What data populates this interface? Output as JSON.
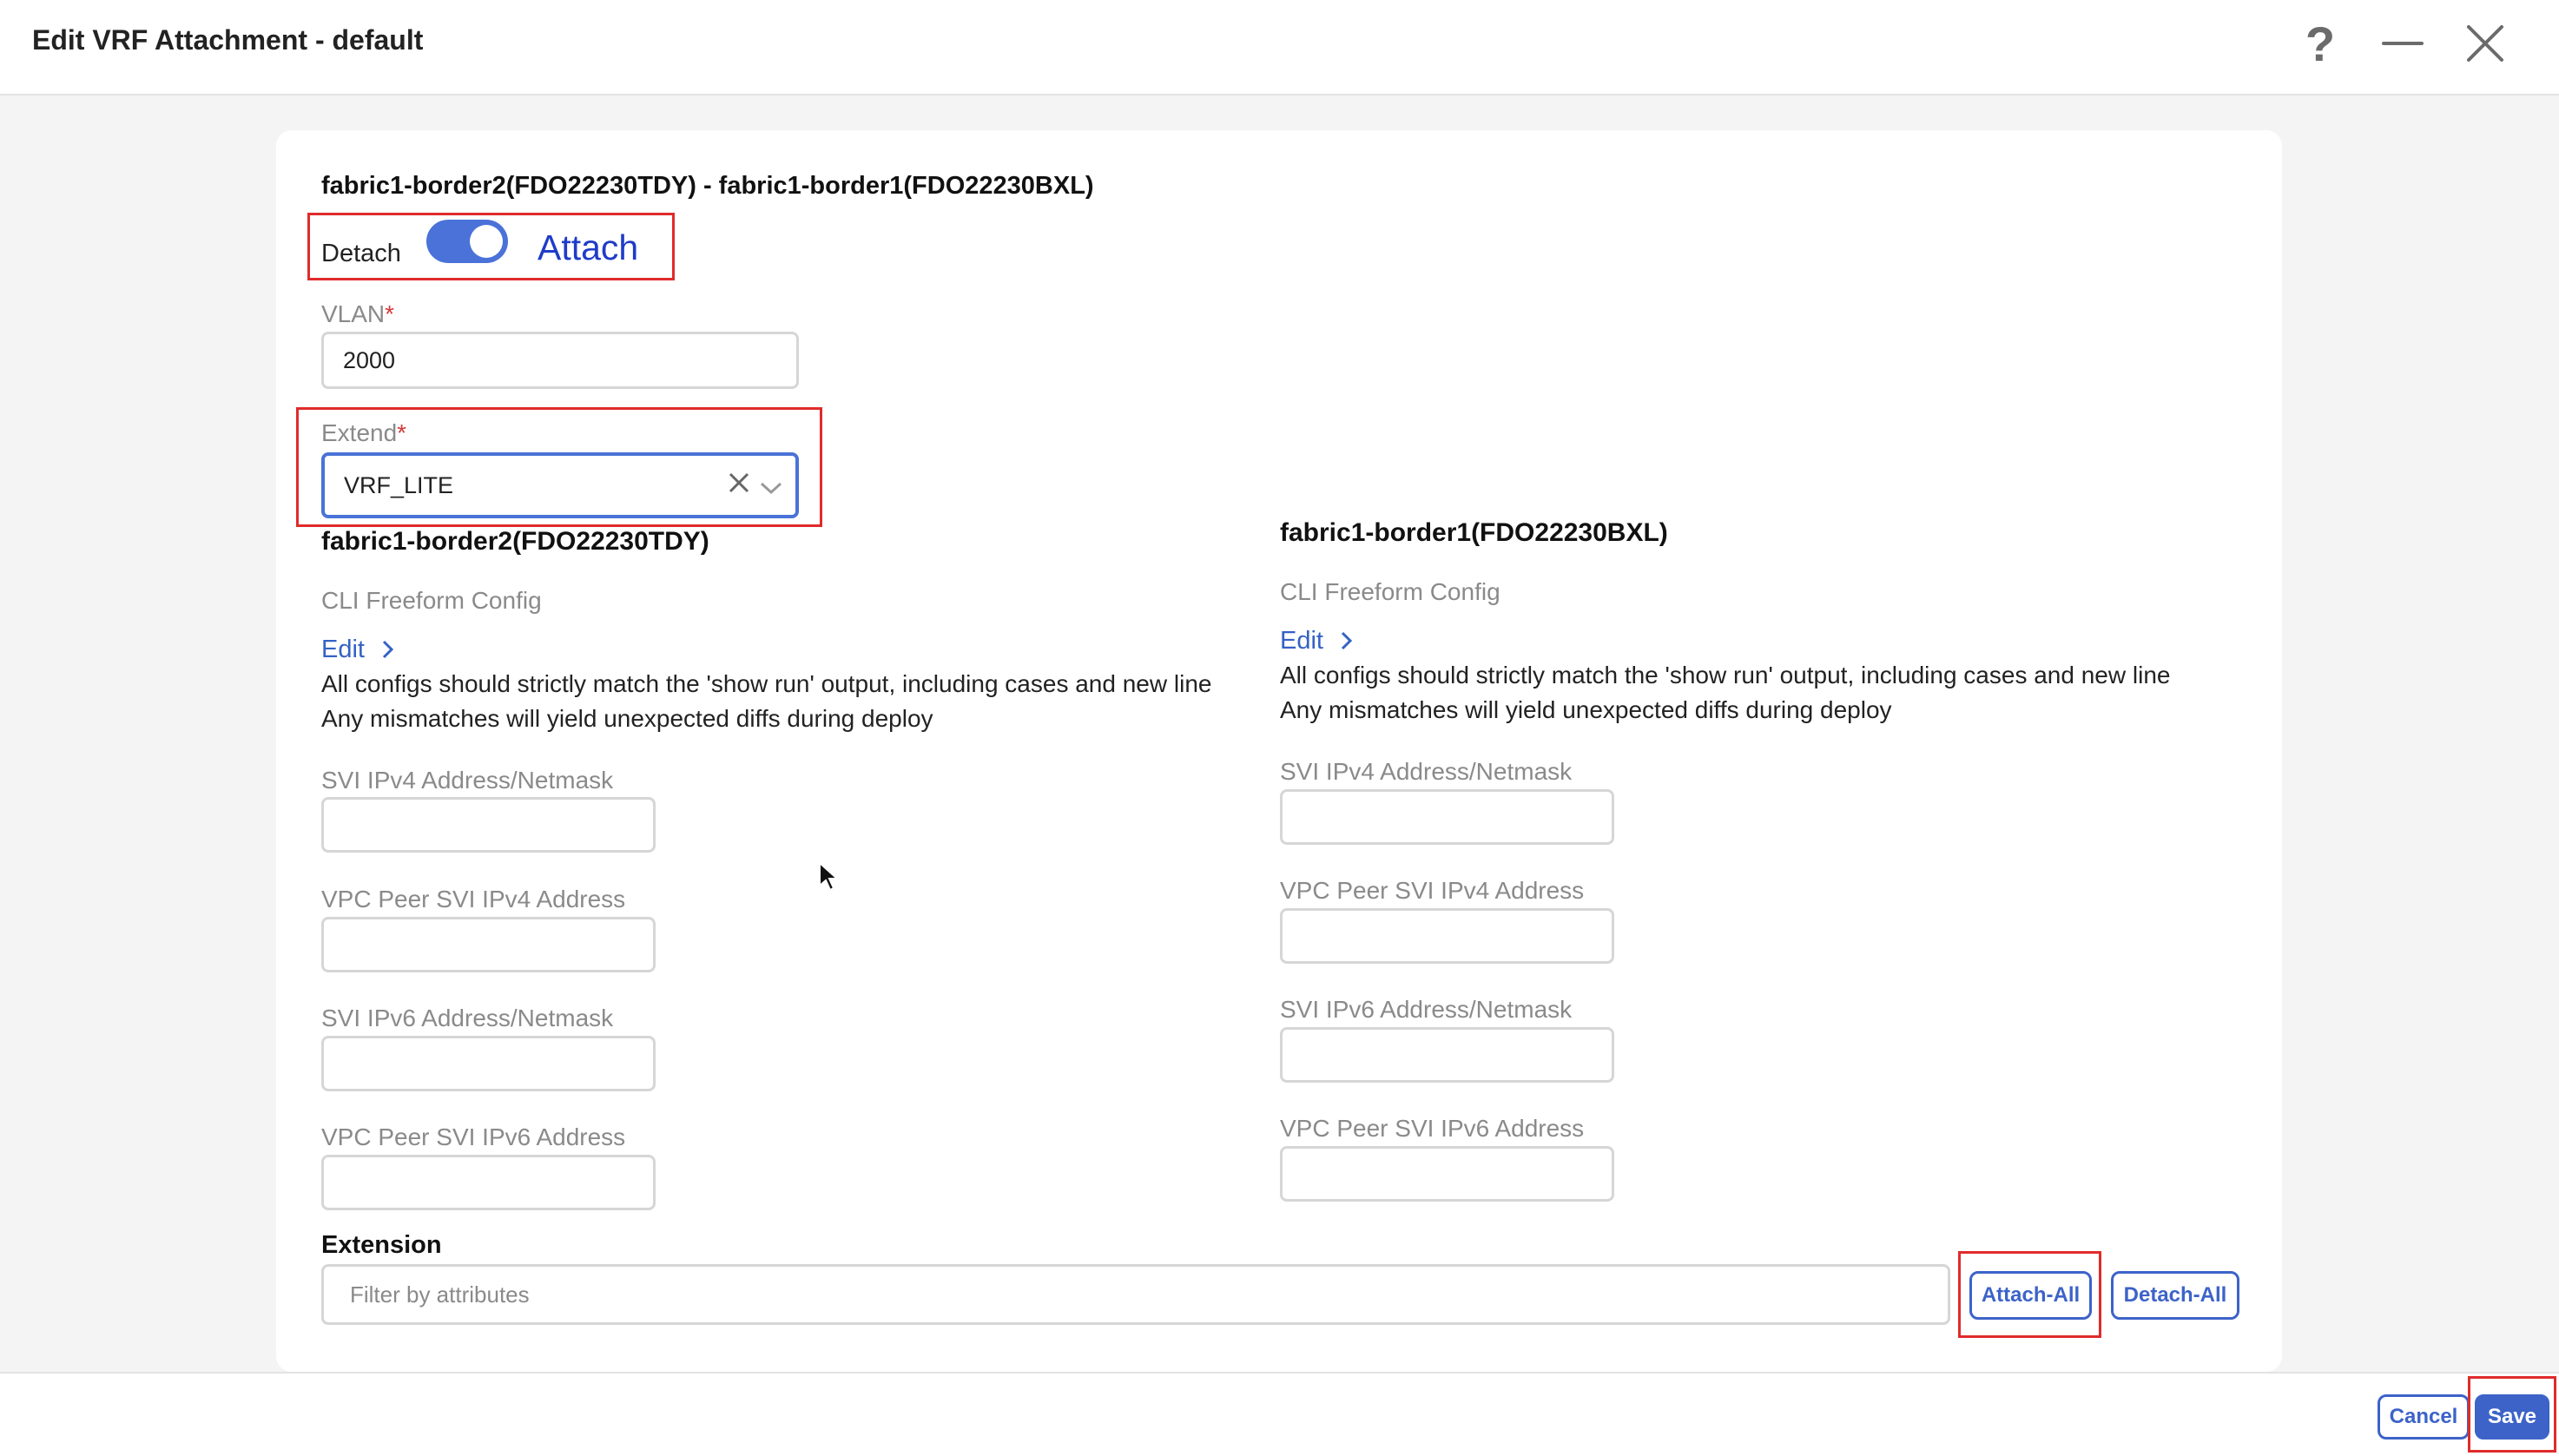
{
  "header": {
    "title": "Edit VRF Attachment - default",
    "icons": [
      "help-icon",
      "minimize-icon",
      "close-icon"
    ]
  },
  "attachment": {
    "pair_title": "fabric1-border2(FDO22230TDY) - fabric1-border1(FDO22230BXL)",
    "detach_label": "Detach",
    "attach_label": "Attach",
    "toggle_state": "attach"
  },
  "vlan": {
    "label": "VLAN",
    "required_mark": "*",
    "value": "2000"
  },
  "extend": {
    "label": "Extend",
    "required_mark": "*",
    "value": "VRF_LITE"
  },
  "left_device": {
    "title": "fabric1-border2(FDO22230TDY)",
    "cli_label": "CLI Freeform Config",
    "edit_label": "Edit",
    "note_line1": "All configs should strictly match the 'show run' output, including cases and new line",
    "note_line2": "Any mismatches will yield unexpected diffs during deploy",
    "svi_ipv4_label": "SVI IPv4 Address/Netmask",
    "vpc_ipv4_label": "VPC Peer SVI IPv4 Address",
    "svi_ipv6_label": "SVI IPv6 Address/Netmask",
    "vpc_ipv6_label": "VPC Peer SVI IPv6 Address",
    "svi_ipv4_value": "",
    "vpc_ipv4_value": "",
    "svi_ipv6_value": "",
    "vpc_ipv6_value": ""
  },
  "right_device": {
    "title": "fabric1-border1(FDO22230BXL)",
    "cli_label": "CLI Freeform Config",
    "edit_label": "Edit",
    "note_line1": "All configs should strictly match the 'show run' output, including cases and new line",
    "note_line2": "Any mismatches will yield unexpected diffs during deploy",
    "svi_ipv4_label": "SVI IPv4 Address/Netmask",
    "vpc_ipv4_label": "VPC Peer SVI IPv4 Address",
    "svi_ipv6_label": "SVI IPv6 Address/Netmask",
    "vpc_ipv6_label": "VPC Peer SVI IPv6 Address",
    "svi_ipv4_value": "",
    "vpc_ipv4_value": "",
    "svi_ipv6_value": "",
    "vpc_ipv6_value": ""
  },
  "extension": {
    "title": "Extension",
    "filter_placeholder": "Filter by attributes",
    "attach_all_label": "Attach-All",
    "detach_all_label": "Detach-All"
  },
  "footer": {
    "cancel_label": "Cancel",
    "save_label": "Save"
  },
  "colors": {
    "accent": "#3d63c9",
    "toggle": "#4a72d8",
    "highlight": "#e02b2b"
  }
}
